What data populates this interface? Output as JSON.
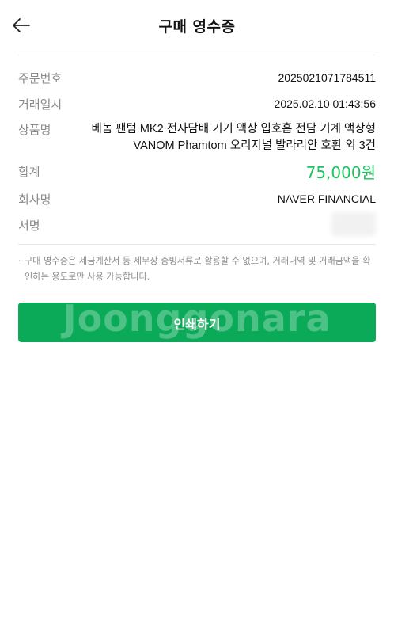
{
  "header": {
    "title": "구매 영수증",
    "back_icon": "back-arrow-icon"
  },
  "receipt": {
    "order_number": {
      "label": "주문번호",
      "value": "2025021071784511"
    },
    "transaction_date": {
      "label": "거래일시",
      "value": "2025.02.10 01:43:56"
    },
    "product": {
      "label": "상품명",
      "value": "베놈 팬텀 MK2 전자담배 기기 액상 입호흡 전담 기계 액상형 VANOM Phamtom 오리지널 발라리안 호환 외 3건"
    },
    "total": {
      "label": "합계",
      "value": "75,000원"
    },
    "company": {
      "label": "회사명",
      "value": "NAVER FINANCIAL"
    },
    "signature": {
      "label": "서명"
    }
  },
  "notice": {
    "bullet": "·",
    "text": "구매 영수증은 세금계산서 등 세무상 증빙서류로 활용할 수 없으며, 거래내역 및 거래금액을 확인하는 용도로만 사용 가능합니다."
  },
  "actions": {
    "print_label": "인쇄하기"
  },
  "watermark": "Joonggonara",
  "colors": {
    "accent_green": "#0aaa59",
    "total_green": "#1ec35e",
    "label_gray": "#8a8a8a"
  }
}
